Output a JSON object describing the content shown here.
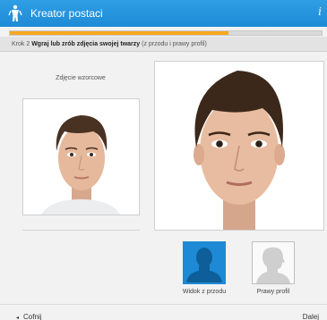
{
  "window": {
    "title": "Kreator postaci",
    "info_icon": "i"
  },
  "progress": {
    "fraction": 0.7
  },
  "step": {
    "number_label": "Krok 2",
    "instruction_bold": "Wgraj lub zrób zdjęcia swojej twarzy",
    "instruction_note": "(z przodu i prawy profil)"
  },
  "reference": {
    "caption": "Zdjęcie wzorcowe"
  },
  "options": {
    "front_label": "Widok z przodu",
    "profile_label": "Prawy profil"
  },
  "footer": {
    "back_label": "Cofnij",
    "next_label": "Dalej",
    "back_arrow_icon": "◂"
  },
  "colors": {
    "accent": "#1e8ad6",
    "progress": "#f5a81e"
  }
}
